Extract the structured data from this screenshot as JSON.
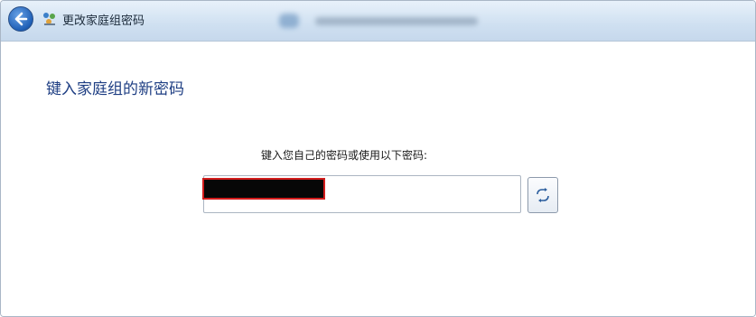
{
  "window": {
    "title": "更改家庭组密码",
    "back_icon": "back-arrow-icon",
    "app_icon": "homegroup-icon"
  },
  "main": {
    "heading": "键入家庭组的新密码",
    "prompt": "键入您自己的密码或使用以下密码:",
    "password_field": {
      "value": "",
      "redacted": true
    },
    "refresh_icon": "refresh-icon"
  },
  "colors": {
    "heading": "#1e3e83",
    "redaction_fill": "#070707",
    "redaction_border": "#d21c1c"
  }
}
